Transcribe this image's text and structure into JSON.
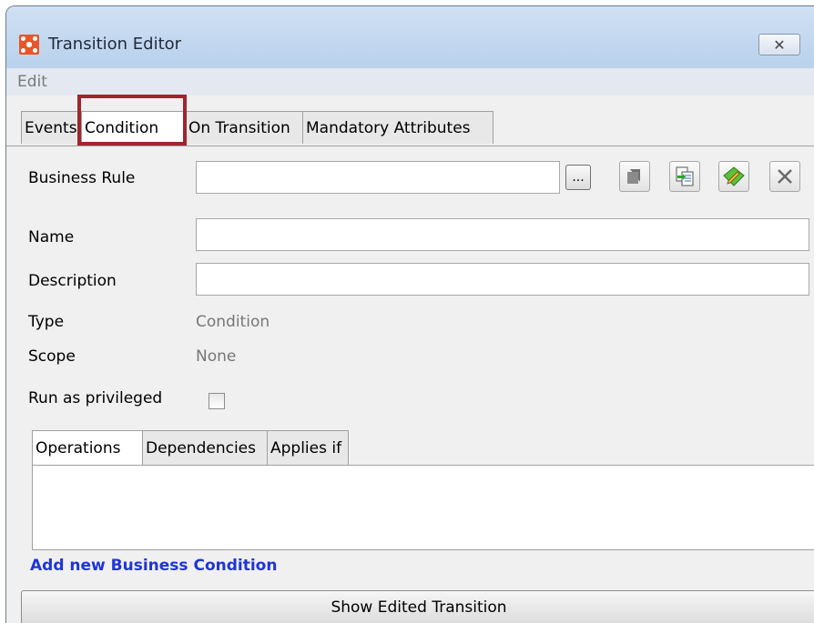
{
  "window": {
    "title": "Transition Editor",
    "close_glyph": "✕"
  },
  "menu": {
    "items": [
      "Edit"
    ]
  },
  "tabs": [
    {
      "label": "Events"
    },
    {
      "label": "Condition",
      "active": true
    },
    {
      "label": "On Transition"
    },
    {
      "label": "Mandatory Attributes"
    }
  ],
  "form": {
    "business_rule": {
      "label": "Business Rule",
      "value": "",
      "browse_label": "..."
    },
    "name": {
      "label": "Name",
      "value": ""
    },
    "description": {
      "label": "Description",
      "value": ""
    },
    "type": {
      "label": "Type",
      "value": "Condition"
    },
    "scope": {
      "label": "Scope",
      "value": "None"
    },
    "run_as_privileged": {
      "label": "Run as privileged",
      "checked": false
    }
  },
  "toolbar_icons": [
    "select-rule-icon",
    "copy-rule-icon",
    "edit-rule-icon",
    "remove-icon"
  ],
  "subtabs": [
    {
      "label": "Operations",
      "active": true
    },
    {
      "label": "Dependencies"
    },
    {
      "label": "Applies if"
    }
  ],
  "actions": {
    "add_link": "Add new Business Condition",
    "show_button": "Show Edited Transition"
  },
  "colors": {
    "highlight": "#a0252d",
    "link": "#1f35d6",
    "app_icon": "#e8552a"
  }
}
